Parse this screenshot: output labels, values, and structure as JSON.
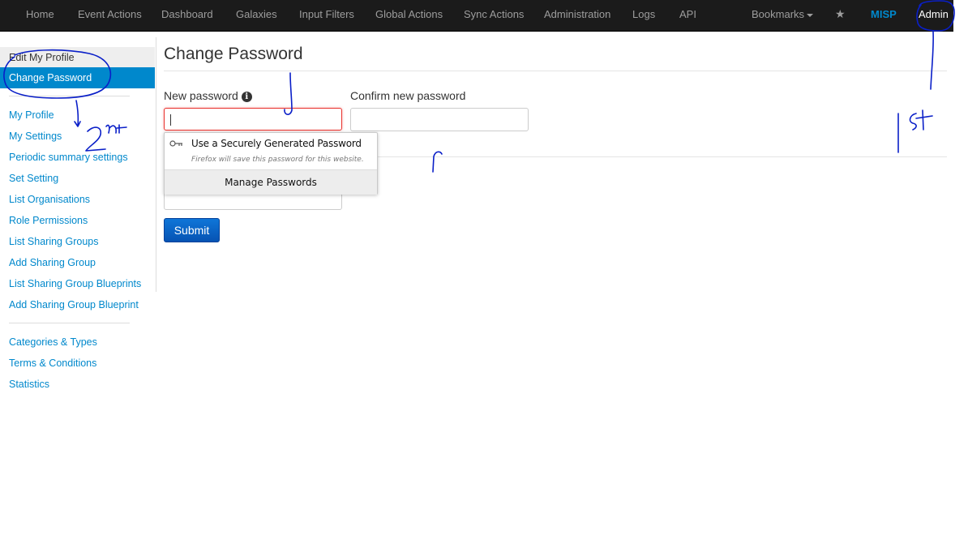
{
  "navbar": {
    "items": [
      "Home",
      "Event Actions",
      "Dashboard",
      "Galaxies",
      "Input Filters",
      "Global Actions",
      "Sync Actions",
      "Administration",
      "Logs",
      "API"
    ],
    "bookmarks": "Bookmarks",
    "brand": "MISP",
    "user": "Admin"
  },
  "sidebar": {
    "edit_profile": "Edit My Profile",
    "change_password": "Change Password",
    "items": [
      "My Profile",
      "My Settings",
      "Periodic summary settings",
      "Set Setting",
      "List Organisations",
      "Role Permissions",
      "List Sharing Groups",
      "Add Sharing Group",
      "List Sharing Group Blueprints",
      "Add Sharing Group Blueprint"
    ],
    "bottom_items": [
      "Categories & Types",
      "Terms & Conditions",
      "Statistics"
    ]
  },
  "main": {
    "title": "Change Password",
    "new_password_label": "New password",
    "confirm_password_label": "Confirm new password",
    "submit": "Submit"
  },
  "popup": {
    "suggestion": "Use a Securely Generated Password",
    "note": "Firefox will save this password for this website.",
    "manage": "Manage Passwords"
  },
  "annotations": {
    "first": "1st",
    "second": "2nd"
  },
  "colors": {
    "navbar_bg": "#1b1b1b",
    "accent": "#0088cc",
    "submit": "#0653b3",
    "annotation_ink": "#0a1fc8"
  }
}
